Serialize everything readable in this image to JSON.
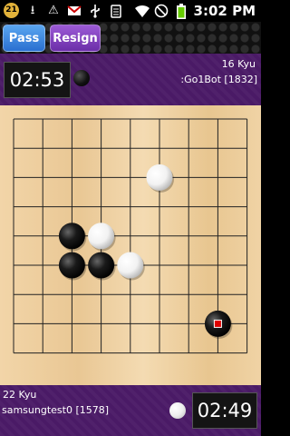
{
  "status_bar": {
    "notification_count": "21",
    "time": "3:02 PM",
    "icons": [
      "notification-badge",
      "download-icon",
      "warning-icon",
      "gmail-icon",
      "usb-icon",
      "clipboard-icon",
      "wifi-icon",
      "no-sync-icon",
      "battery-icon"
    ]
  },
  "buttons": {
    "pass_label": "Pass",
    "resign_label": "Resign"
  },
  "opponent": {
    "clock": "02:53",
    "rank": "16 Kyu",
    "name": ":Go1Bot [1832]",
    "stone": "black"
  },
  "player": {
    "clock": "02:49",
    "rank": "22 Kyu",
    "name": "samsungtest0 [1578]",
    "stone": "white"
  },
  "board": {
    "size": 9,
    "stones": [
      {
        "color": "white",
        "col": 5,
        "row": 2
      },
      {
        "color": "black",
        "col": 2,
        "row": 4
      },
      {
        "color": "white",
        "col": 3,
        "row": 4
      },
      {
        "color": "black",
        "col": 2,
        "row": 5
      },
      {
        "color": "black",
        "col": 3,
        "row": 5
      },
      {
        "color": "white",
        "col": 4,
        "row": 5
      },
      {
        "color": "black",
        "col": 7,
        "row": 7,
        "last_move": true
      }
    ],
    "last_move_marker_color": "#e00000"
  }
}
